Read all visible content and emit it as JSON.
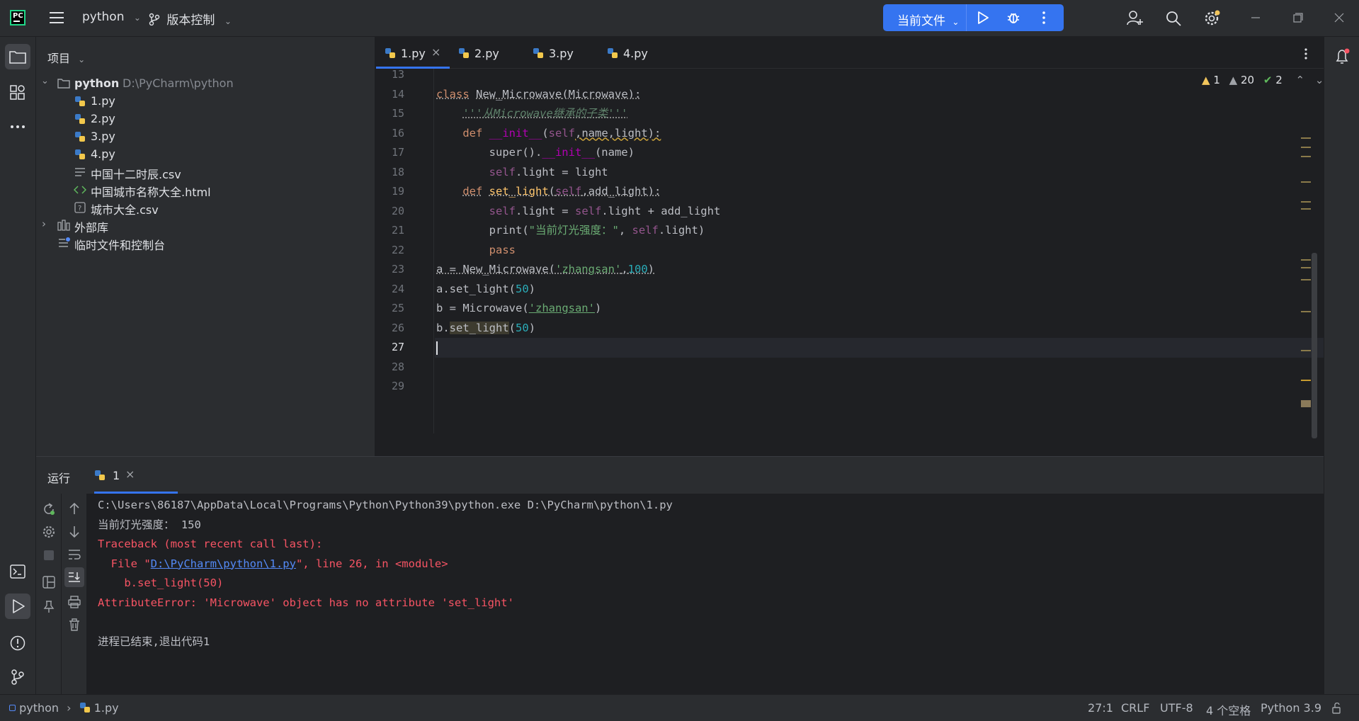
{
  "app": {
    "project_name": "python",
    "vcs_label": "版本控制",
    "run_config": "当前文件"
  },
  "project_panel": {
    "title": "项目",
    "root_name": "python",
    "root_path": "D:\\PyCharm\\python",
    "files": [
      "1.py",
      "2.py",
      "3.py",
      "4.py",
      "中国十二时辰.csv",
      "中国城市名称大全.html",
      "城市大全.csv"
    ],
    "external_libs": "外部库",
    "scratches": "临时文件和控制台"
  },
  "editor": {
    "tabs": [
      "1.py",
      "2.py",
      "3.py",
      "4.py"
    ],
    "active_tab": "1.py",
    "inspections": {
      "warnings": "1",
      "weak_warnings": "20",
      "ok": "2"
    },
    "line_numbers": [
      "13",
      "14",
      "15",
      "16",
      "17",
      "18",
      "19",
      "20",
      "21",
      "22",
      "23",
      "24",
      "25",
      "26",
      "27",
      "28",
      "29"
    ],
    "code": {
      "l14_kw": "class",
      "l14_name": "New_Microwave",
      "l14_rest": "(Microwave):",
      "l15": "'''从Microwave继承的子类'''",
      "l16_kw": "def",
      "l16_fn": "__init__",
      "l16_p1": "(",
      "l16_self": "self",
      "l16_p2": ",name,light):",
      "l17_a": "super().",
      "l17_fn": "__init__",
      "l17_b": "(name)",
      "l18_self": "self",
      "l18_rest": ".light = light",
      "l19_kw": "def",
      "l19_fn": "set_light",
      "l19_p1": "(",
      "l19_self": "self",
      "l19_p2": ",add_light):",
      "l20_self1": "self",
      "l20_mid": ".light = ",
      "l20_self2": "self",
      "l20_end": ".light + add_light",
      "l21_a": "print(",
      "l21_str": "\"当前灯光强度：\"",
      "l21_b": ", ",
      "l21_self": "self",
      "l21_c": ".light)",
      "l22": "pass",
      "l23_a": "a = New_Microwave(",
      "l23_str": "'zhangsan'",
      "l23_comma": ",",
      "l23_num": "100",
      "l23_end": ")",
      "l24_a": "a.set_light(",
      "l24_num": "50",
      "l24_end": ")",
      "l25_a": "b = Microwave(",
      "l25_str": "'zhangsan'",
      "l25_end": ")",
      "l26_a": "b.",
      "l26_fn": "set_light",
      "l26_b": "(",
      "l26_num": "50",
      "l26_end": ")"
    }
  },
  "run_panel": {
    "title": "运行",
    "tab_label": "1",
    "output": {
      "cmd": "C:\\Users\\86187\\AppData\\Local\\Programs\\Python\\Python39\\python.exe D:\\PyCharm\\python\\1.py",
      "print_line": "当前灯光强度： 150",
      "traceback": "Traceback (most recent call last):",
      "file_pre": "  File \"",
      "file_link": "D:\\PyCharm\\python\\1.py",
      "file_post": "\", line 26, in <module>",
      "code_line": "    b.set_light(50)",
      "error": "AttributeError: 'Microwave' object has no attribute 'set_light'",
      "exit": "进程已结束,退出代码1"
    }
  },
  "status_bar": {
    "crumb_project": "python",
    "crumb_file": "1.py",
    "position": "27:1",
    "line_ending": "CRLF",
    "encoding": "UTF-8",
    "indent": "4 个空格",
    "interpreter": "Python 3.9"
  },
  "colors": {
    "accent": "#3574f0",
    "background": "#1e1f22",
    "panel": "#2b2d30",
    "error": "#f75464"
  }
}
